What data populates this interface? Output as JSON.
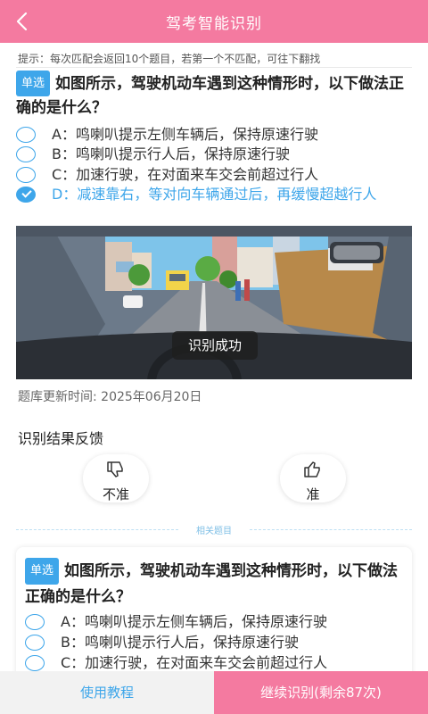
{
  "header": {
    "title": "驾考智能识别"
  },
  "tip": "提示：每次匹配会返回10个题目，若第一个不匹配，可往下翻找",
  "question": {
    "type": "单选",
    "text": "如图所示，驾驶机动车遇到这种情形时，以下做法正确的是什么？",
    "options": [
      {
        "text": "A：鸣喇叭提示左侧车辆后，保持原速行驶",
        "selected": false
      },
      {
        "text": "B：鸣喇叭提示行人后，保持原速行驶",
        "selected": false
      },
      {
        "text": "C：加速行驶，在对面来车交会前超过行人",
        "selected": false
      },
      {
        "text": "D：减速靠右，等对向车辆通过后，再缓慢超越行人",
        "selected": true
      }
    ]
  },
  "toast": "识别成功",
  "update_time": "题库更新时间: 2025年06月20日",
  "feedback": {
    "title": "识别结果反馈",
    "dislike_label": "不准",
    "like_label": "准"
  },
  "related": {
    "divider_label": "相关题目",
    "question": {
      "type": "单选",
      "text": "如图所示，驾驶机动车遇到这种情形时，以下做法正确的是什么？",
      "options": [
        {
          "text": "A：鸣喇叭提示左侧车辆后，保持原速行驶"
        },
        {
          "text": "B：鸣喇叭提示行人后，保持原速行驶"
        },
        {
          "text": "C：加速行驶，在对面来车交会前超过行人"
        }
      ]
    }
  },
  "bottom": {
    "tutorial_label": "使用教程",
    "continue_label": "继续识别(剩余87次)"
  },
  "colors": {
    "accent_pink": "#f47aa0",
    "accent_blue": "#3ea6ea"
  },
  "icons": {
    "back": "chevron-left-icon",
    "dislike": "thumbs-down-icon",
    "like": "thumbs-up-icon"
  }
}
